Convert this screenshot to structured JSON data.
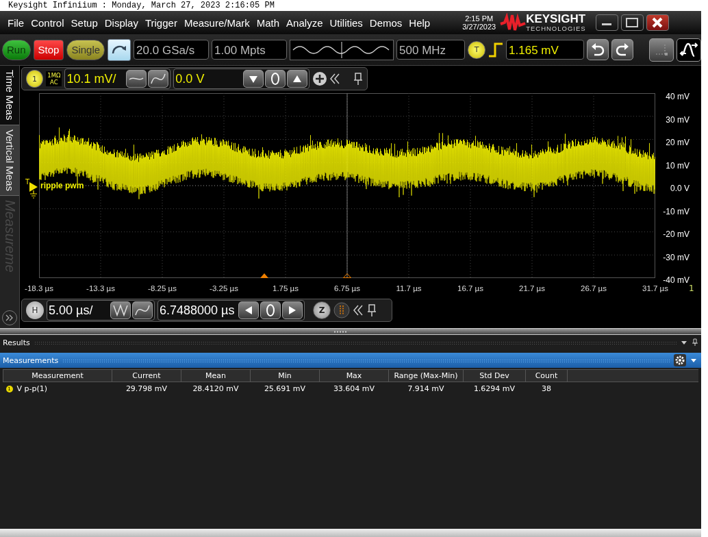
{
  "title_bar": {
    "text": "Keysight Infiniium : Monday, March 27, 2023 2:16:05 PM"
  },
  "menu": [
    "File",
    "Control",
    "Setup",
    "Display",
    "Trigger",
    "Measure/Mark",
    "Math",
    "Analyze",
    "Utilities",
    "Demos",
    "Help"
  ],
  "clock": {
    "time": "2:15 PM",
    "date": "3/27/2023"
  },
  "logo": {
    "name": "KEYSIGHT",
    "sub": "TECHNOLOGIES"
  },
  "toolbar": {
    "acq_buttons": [
      {
        "label": "Run",
        "kind": "run"
      },
      {
        "label": "Stop",
        "kind": "stop"
      },
      {
        "label": "Single",
        "kind": "single"
      }
    ],
    "sample_rate": "20.0 GSa/s",
    "memory_depth": "1.00 Mpts",
    "bandwidth": "500 MHz",
    "trigger_badge": "T",
    "trigger_level": "1.165 mV"
  },
  "side_tabs": [
    {
      "label": "Time Meas",
      "selected": true,
      "disabled": false
    },
    {
      "label": "Vertical Meas",
      "selected": false,
      "disabled": false
    },
    {
      "label": "Measureme",
      "selected": false,
      "disabled": true
    }
  ],
  "channel": {
    "number": "1",
    "impedance": "1MΩ",
    "coupling": "AC",
    "scale": "10.1 mV/",
    "offset": "0.0 V"
  },
  "plot": {
    "trace_label": "ripple pwm",
    "ground_marker": "T",
    "y_labels": [
      "40 mV",
      "30 mV",
      "20 mV",
      "10 mV",
      "0.0 V",
      "-10 mV",
      "-20 mV",
      "-30 mV",
      "-40 mV"
    ],
    "x_labels": [
      "-18.3 µs",
      "-13.3 µs",
      "-8.25 µs",
      "-3.25 µs",
      "1.75 µs",
      "6.75 µs",
      "11.7 µs",
      "16.7 µs",
      "21.7 µs",
      "26.7 µs",
      "31.7 µs"
    ],
    "edge_label": "1"
  },
  "horizontal": {
    "badge": "H",
    "scale": "5.00 µs/",
    "position": "6.7488000 µs",
    "zoom_badge": "Z"
  },
  "results": {
    "title": "Results",
    "panel_title": "Measurements",
    "columns": [
      "Measurement",
      "Current",
      "Mean",
      "Min",
      "Max",
      "Range (Max-Min)",
      "Std Dev",
      "Count"
    ],
    "rows": [
      {
        "source": "1",
        "cells": [
          "V p-p(1)",
          "29.798 mV",
          "28.4120 mV",
          "25.691 mV",
          "33.604 mV",
          "7.914 mV",
          "1.6294 mV",
          "38"
        ]
      }
    ]
  }
}
